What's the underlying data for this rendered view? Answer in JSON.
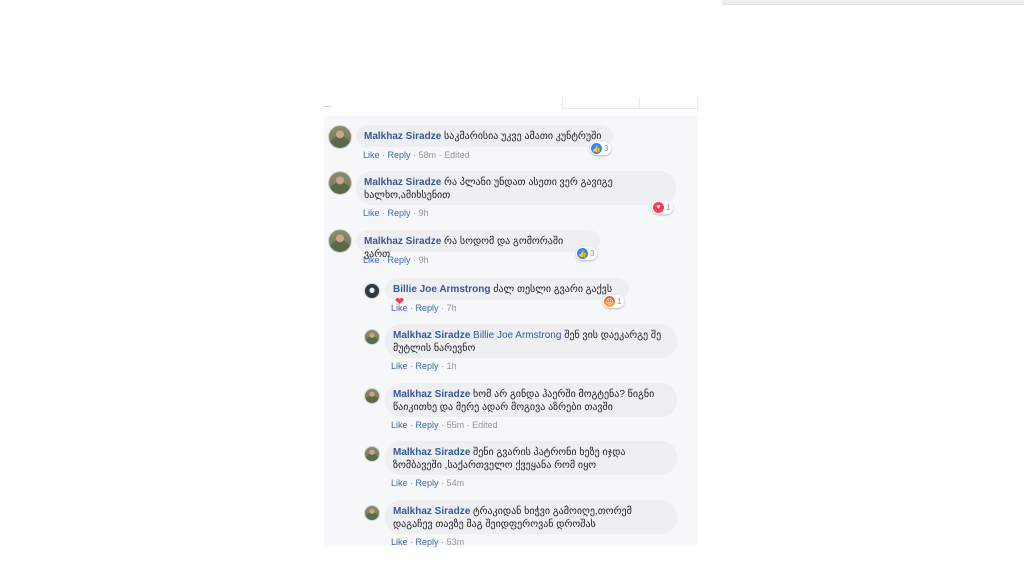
{
  "comments": [
    {
      "author": "Malkhaz Siradze",
      "text": "საკმარისია უკვე ამათი კუნტრუში",
      "like": "Like",
      "reply": "Reply",
      "time": "58m",
      "edited": "Edited",
      "reaction_count": "3"
    },
    {
      "author": "Malkhaz Siradze",
      "text": "რა პლანი უნდათ ასეთი ვერ გავიგე ხალხო,ამიხსენით",
      "like": "Like",
      "reply": "Reply",
      "time": "9h",
      "reaction_count": "1"
    },
    {
      "author": "Malkhaz Siradze",
      "text": "რა სოდომ და გომორაში ვართ",
      "like": "Like",
      "reply": "Reply",
      "time": "9h",
      "reaction_count": "3"
    }
  ],
  "replies": [
    {
      "author": "Billie Joe Armstrong",
      "text": "ძალ თესლი გვარი გაქვს",
      "like": "Like",
      "reply": "Reply",
      "time": "7h",
      "reaction_count": "1"
    },
    {
      "author": "Malkhaz Siradze",
      "mention": "Billie Joe Armstrong",
      "text": "შენ ვის დაეკარგე შე მუტლის ნარევნო",
      "like": "Like",
      "reply": "Reply",
      "time": "1h"
    },
    {
      "author": "Malkhaz Siradze",
      "text": "ხომ არ გინდა ჰაერში მოგტენა? წიგნი წაიკითხე და მერე ადარ მოგივა აზრები თავში",
      "like": "Like",
      "reply": "Reply",
      "time": "55m",
      "edited": "Edited"
    },
    {
      "author": "Malkhaz Siradze",
      "text": "შენი გვარის პატრონი ხეზე იჯდა ზომბავეში ,საქართველო ქვეყანა რომ იყო",
      "like": "Like",
      "reply": "Reply",
      "time": "54m"
    },
    {
      "author": "Malkhaz Siradze",
      "text": "ტრაკიდან ხიჭვი გამოიღე,თორემ დაგაჩევ თავზე მაგ შეიდფეროვან დროშას",
      "like": "Like",
      "reply": "Reply",
      "time": "53m"
    }
  ],
  "separator": "·",
  "icons": {
    "like": "thumbs-up-icon",
    "love": "heart-icon",
    "angry": "angry-face-icon"
  },
  "colors": {
    "link": "#4267b2",
    "author": "#385898",
    "meta": "#90949c",
    "bubble": "#edeff2",
    "panel": "#f6f7f9"
  }
}
